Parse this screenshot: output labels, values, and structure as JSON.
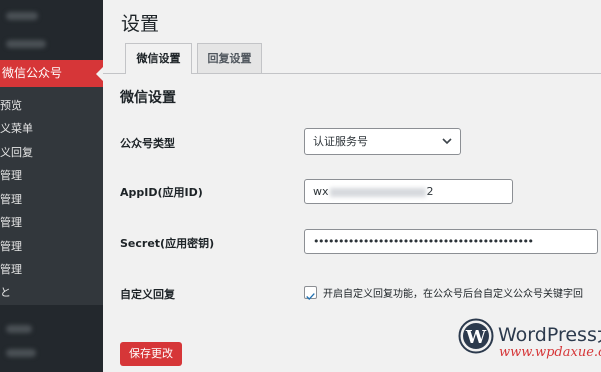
{
  "sidebar": {
    "active_label": "微信公众号",
    "sub_items": [
      "预览",
      "义菜单",
      "义回复",
      "管理",
      "管理",
      "管理",
      "管理",
      "管理",
      "と"
    ]
  },
  "page": {
    "title": "设置"
  },
  "tabs": [
    {
      "label": "微信设置",
      "active": true
    },
    {
      "label": "回复设置",
      "active": false
    }
  ],
  "section": {
    "title": "微信设置"
  },
  "fields": {
    "account_type": {
      "label": "公众号类型",
      "value": "认证服务号"
    },
    "appid": {
      "label": "AppID(应用ID)",
      "value_start": "wx",
      "value_end": "2"
    },
    "secret": {
      "label": "Secret(应用密钥)",
      "value": "••••••••••••••••••••••••••••••••••••••••••••"
    },
    "custom_reply": {
      "label": "自定义回复",
      "checked": true,
      "checkbox_text": "开启自定义回复功能，在公众号后台自定义公众号关键字回"
    }
  },
  "actions": {
    "save_label": "保存更改"
  },
  "watermark": {
    "brand": "WordPress大",
    "url": "www.wpdaxue.com"
  },
  "colors": {
    "accent": "#d63638",
    "sidebar_bg": "#23282d",
    "submenu_bg": "#32373c",
    "page_bg": "#f1f1f1"
  }
}
